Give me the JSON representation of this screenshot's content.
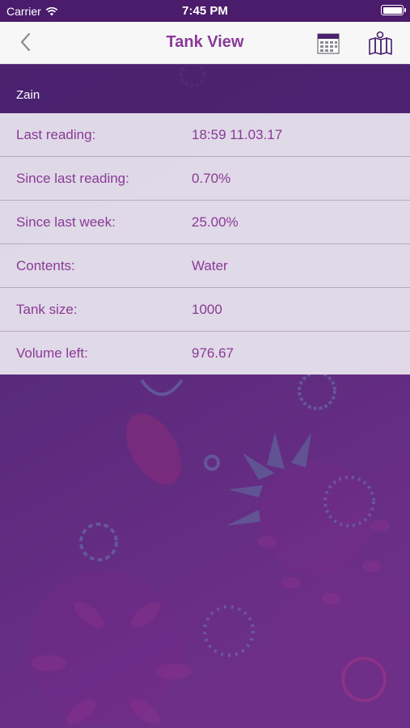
{
  "status_bar": {
    "carrier": "Carrier",
    "time": "7:45 PM"
  },
  "nav": {
    "title": "Tank View",
    "icons": [
      "back-chevron-icon",
      "calendar-icon",
      "map-icon"
    ]
  },
  "tank": {
    "name": "Zain"
  },
  "details": [
    {
      "label": "Last reading:",
      "value": "18:59 11.03.17"
    },
    {
      "label": "Since last reading:",
      "value": "0.70%"
    },
    {
      "label": "Since last week:",
      "value": "25.00%"
    },
    {
      "label": "Contents:",
      "value": "Water"
    },
    {
      "label": "Tank size:",
      "value": "1000"
    },
    {
      "label": "Volume left:",
      "value": "976.67"
    }
  ],
  "colors": {
    "accent": "#8a3a96",
    "background": "#4a1f6e",
    "header": "#4a226e"
  }
}
